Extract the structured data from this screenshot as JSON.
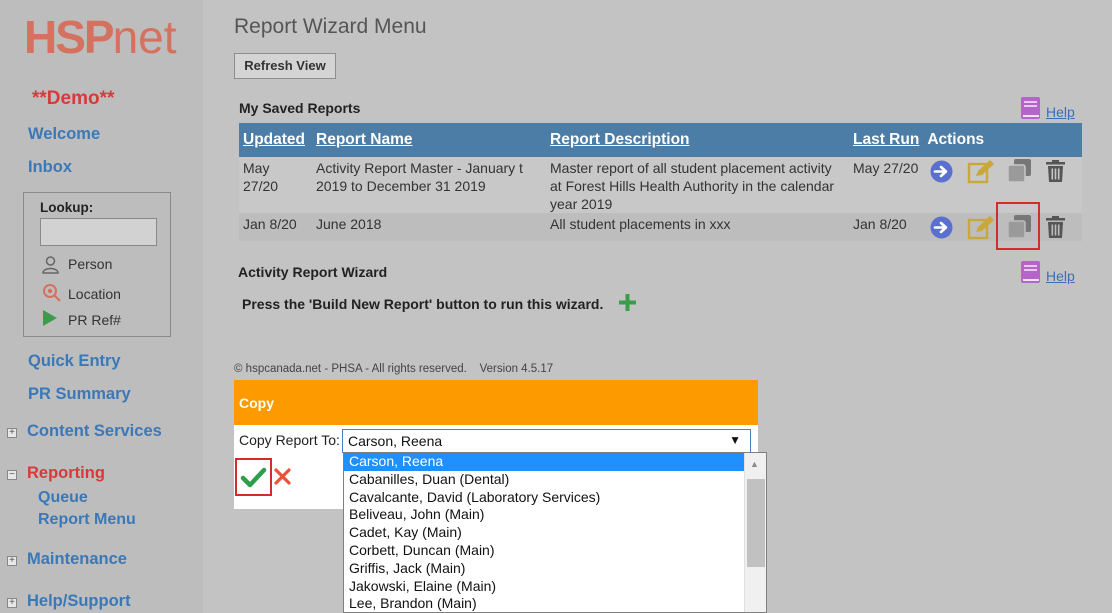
{
  "app": {
    "logo_hsp": "HSP",
    "logo_net": "net",
    "demo_label": "**Demo**"
  },
  "sidebar": {
    "welcome": "Welcome",
    "inbox": "Inbox",
    "lookup": {
      "label": "Lookup:",
      "input_value": "",
      "items": [
        {
          "label": "Person",
          "icon": "person-icon"
        },
        {
          "label": "Location",
          "icon": "location-pin-icon"
        },
        {
          "label": "PR Ref#",
          "icon": "play-icon"
        }
      ]
    },
    "quick_entry": "Quick Entry",
    "pr_summary": "PR Summary",
    "content_services": "Content Services",
    "reporting": "Reporting",
    "queue": "Queue",
    "report_menu": "Report Menu",
    "maintenance": "Maintenance",
    "help_support": "Help/Support",
    "expander_symbol": "+",
    "collapse_symbol": "−"
  },
  "main": {
    "title": "Report Wizard Menu",
    "refresh_button": "Refresh View",
    "saved_reports_title": "My Saved Reports",
    "help_label": "Help",
    "table": {
      "headers": [
        "Updated",
        "Report Name",
        "Report Description",
        "Last Run",
        "Actions"
      ],
      "rows": [
        {
          "updated": "May 27/20",
          "name": "Activity Report Master - January t 2019 to December 31 2019",
          "description": "Master report of all student placement activity at Forest Hills Health Authority in the calendar year 2019",
          "last_run": "May 27/20"
        },
        {
          "updated": "Jan 8/20",
          "name": "June 2018",
          "description": "All student placements in xxx",
          "last_run": "Jan 8/20"
        }
      ]
    },
    "wizard_title": "Activity Report Wizard",
    "wizard_help_label": "Help",
    "wizard_text": "Press the 'Build New Report' button to run this wizard.",
    "footer_copyright": "© hspcanada.net - PHSA - All rights reserved.",
    "footer_version": "Version 4.5.17"
  },
  "copy_dialog": {
    "title": "Copy",
    "label": "Copy Report To:",
    "selected_value": "Carson, Reena",
    "options": [
      "Carson, Reena",
      "Cabanilles, Duan (Dental)",
      "Cavalcante, David (Laboratory Services)",
      "Beliveau, John (Main)",
      "Cadet, Kay (Main)",
      "Corbett, Duncan (Main)",
      "Griffis, Jack (Main)",
      "Jakowski, Elaine (Main)",
      "Lee, Brandon (Main)"
    ]
  },
  "colors": {
    "header_blue": "#4b7da6",
    "dialog_orange": "#fd9a00",
    "link_blue": "#3a78b8",
    "active_red": "#d63a3a",
    "highlight_red": "#d62b2b"
  }
}
